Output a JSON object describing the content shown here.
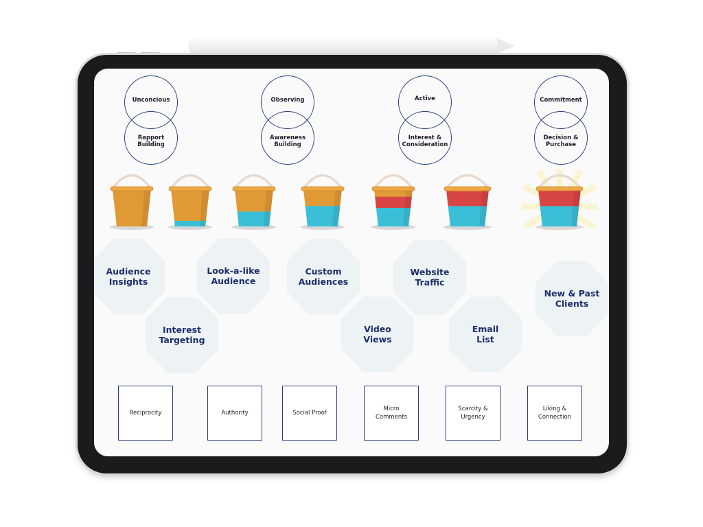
{
  "stages": [
    {
      "top": "Unconcious",
      "bottom": "Rapport\nBuilding"
    },
    {
      "top": "Observing",
      "bottom": "Awareness\nBuilding"
    },
    {
      "top": "Active",
      "bottom": "Interest &\nConsideration"
    },
    {
      "top": "Commitment",
      "bottom": "Decision &\nPurchase"
    }
  ],
  "buckets": [
    {
      "blue_fill": 0,
      "red_fill": 0
    },
    {
      "blue_fill": 0.15,
      "red_fill": 0
    },
    {
      "blue_fill": 0.4,
      "red_fill": 0
    },
    {
      "blue_fill": 0.55,
      "red_fill": 0
    },
    {
      "blue_fill": 0.5,
      "red_fill": 0.3
    },
    {
      "blue_fill": 0.55,
      "red_fill": 0.4
    },
    {
      "blue_fill": 0.55,
      "red_fill": 0.45,
      "glowing": true
    }
  ],
  "audiences": [
    {
      "label": "Audience\nInsights"
    },
    {
      "label": "Interest\nTargeting"
    },
    {
      "label": "Look-a-like\nAudience"
    },
    {
      "label": "Custom\nAudiences"
    },
    {
      "label": "Video\nViews"
    },
    {
      "label": "Website\nTraffic"
    },
    {
      "label": "Email\nList"
    },
    {
      "label": "New & Past\nClients"
    }
  ],
  "principles": [
    {
      "label": "Reciprocity"
    },
    {
      "label": "Authority"
    },
    {
      "label": "Social Proof"
    },
    {
      "label": "Micro\nComments"
    },
    {
      "label": "Scarcity &\nUrgency"
    },
    {
      "label": "Liking &\nConnection"
    }
  ],
  "colors": {
    "navy": "#1d2f6b",
    "bucket_orange": "#e09a35",
    "water_blue": "#3bbfd8",
    "water_red": "#d84545"
  }
}
